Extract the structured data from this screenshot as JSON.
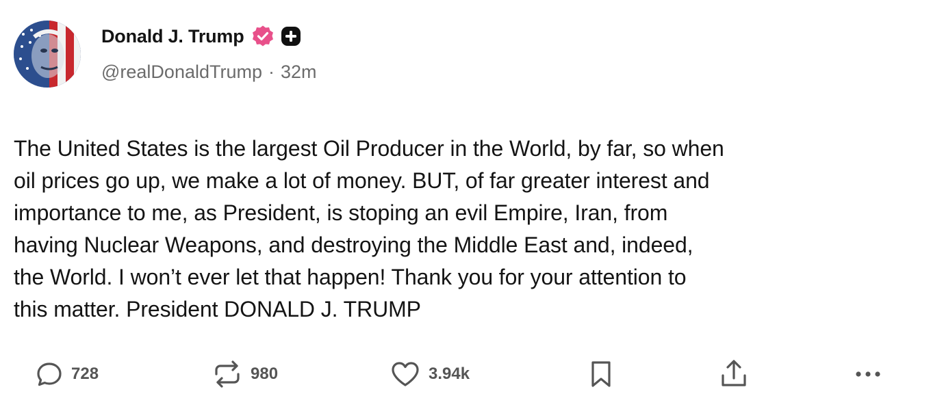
{
  "author": {
    "display_name": "Donald J. Trump",
    "handle": "@realDonaldTrump",
    "separator": "·",
    "time": "32m",
    "avatar_icon": "flag-portrait-avatar",
    "verified_icon": "verified-badge-icon",
    "verified_color": "#e8508a",
    "plus_icon": "plus-badge-icon"
  },
  "post": {
    "text": "The United States is the largest Oil Producer in the World, by far, so when\noil prices go up, we make a lot of money. BUT, of far greater interest and\nimportance to me, as President, is stoping an evil Empire, Iran, from\nhaving Nuclear Weapons, and destroying the Middle East and, indeed,\nthe World. I won’t ever let that happen! Thank you for your attention to\nthis matter. President DONALD J. TRUMP"
  },
  "actions": {
    "reply": {
      "icon": "reply-bubble-icon",
      "count": "728"
    },
    "repost": {
      "icon": "repost-arrows-icon",
      "count": "980"
    },
    "like": {
      "icon": "heart-icon",
      "count": "3.94k"
    },
    "bookmark": {
      "icon": "bookmark-icon"
    },
    "share": {
      "icon": "share-upload-icon"
    },
    "more": {
      "icon": "more-dots-icon"
    }
  },
  "colors": {
    "text": "#141414",
    "muted": "#6b6b6b",
    "icon": "#555555",
    "background": "#ffffff"
  }
}
